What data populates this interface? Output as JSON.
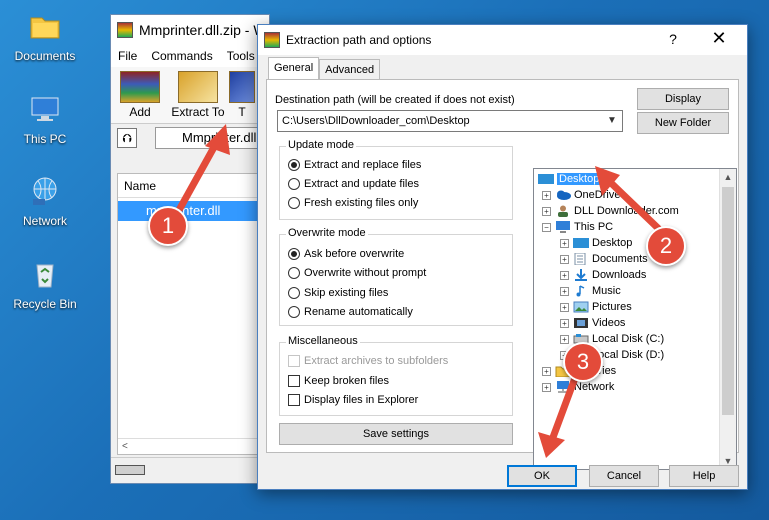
{
  "desktop": {
    "icons": [
      {
        "label": "Documents",
        "icon": "folder-icon"
      },
      {
        "label": "This PC",
        "icon": "computer-icon"
      },
      {
        "label": "Network",
        "icon": "network-icon"
      },
      {
        "label": "Recycle Bin",
        "icon": "recycle-bin-icon"
      }
    ]
  },
  "winrar": {
    "title": "Mmprinter.dll.zip - W",
    "menu": [
      "File",
      "Commands",
      "Tools"
    ],
    "toolbar": {
      "add_label": "Add",
      "extract_label": "Extract To",
      "third_label": "T"
    },
    "address": "Mmprinter.dll",
    "list_header": "Name",
    "file_row": "mmprinter.dll",
    "scroll_left": "<"
  },
  "dialog": {
    "title": "Extraction path and options",
    "help": "?",
    "close": "✕",
    "tabs": [
      "General",
      "Advanced"
    ],
    "destination_label": "Destination path (will be created if does not exist)",
    "destination_value": "C:\\Users\\DllDownloader_com\\Desktop",
    "display_button": "Display",
    "new_folder_button": "New Folder",
    "update_mode": {
      "title": "Update mode",
      "options": [
        "Extract and replace files",
        "Extract and update files",
        "Fresh existing files only"
      ],
      "selected": 0
    },
    "overwrite_mode": {
      "title": "Overwrite mode",
      "options": [
        "Ask before overwrite",
        "Overwrite without prompt",
        "Skip existing files",
        "Rename automatically"
      ],
      "selected": 0
    },
    "misc": {
      "title": "Miscellaneous",
      "options": [
        "Extract archives to subfolders",
        "Keep broken files",
        "Display files in Explorer"
      ]
    },
    "save_settings": "Save settings",
    "tree": [
      {
        "label": "Desktop",
        "icon": "desktop-icon",
        "selected": true
      },
      {
        "label": "OneDrive",
        "icon": "onedrive-icon"
      },
      {
        "label": "DLL Downloader.com",
        "icon": "user-icon"
      },
      {
        "label": "This PC",
        "icon": "computer-icon"
      },
      {
        "label": "Desktop",
        "icon": "desktop-icon"
      },
      {
        "label": "Documents",
        "icon": "documents-icon"
      },
      {
        "label": "Downloads",
        "icon": "downloads-icon"
      },
      {
        "label": "Music",
        "icon": "music-icon"
      },
      {
        "label": "Pictures",
        "icon": "pictures-icon"
      },
      {
        "label": "Videos",
        "icon": "videos-icon"
      },
      {
        "label": "Local Disk (C:)",
        "icon": "disk-icon"
      },
      {
        "label": "Local Disk (D:)",
        "icon": "disk-icon"
      },
      {
        "label": "Libraries",
        "icon": "libraries-icon"
      },
      {
        "label": "Network",
        "icon": "network-icon"
      }
    ],
    "ok_button": "OK",
    "cancel_button": "Cancel",
    "help_button": "Help"
  },
  "annotations": [
    "1",
    "2",
    "3"
  ],
  "colors": {
    "accent": "#0078d7",
    "selection": "#3399ff",
    "annotation": "#e34b3a"
  }
}
